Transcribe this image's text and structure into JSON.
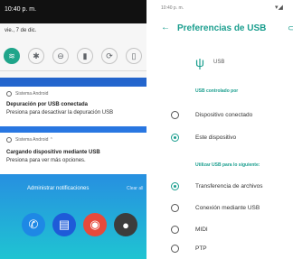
{
  "left": {
    "status_time": "10:40 p. m.",
    "date": "vie., 7 de dic.",
    "tiles": [
      {
        "icon": "wifi-icon",
        "glyph": "≋",
        "on": true
      },
      {
        "icon": "bluetooth-icon",
        "glyph": "✱",
        "on": false
      },
      {
        "icon": "dnd-icon",
        "glyph": "⊖",
        "on": false
      },
      {
        "icon": "flashlight-icon",
        "glyph": "▮",
        "on": false
      },
      {
        "icon": "autorotate-icon",
        "glyph": "⟳",
        "on": false
      },
      {
        "icon": "battery-saver-icon",
        "glyph": "▯",
        "on": false
      }
    ],
    "notifications": [
      {
        "app": "Sistema Android",
        "title": "Depuración por USB conectada",
        "body": "Presiona para desactivar la depuración USB"
      },
      {
        "app": "Sistema Android ⌃",
        "title": "Cargando dispositivo mediante USB",
        "body": "Presiona para ver más opciones."
      }
    ],
    "manage": "Administrar notificaciones",
    "clear": "Clear all",
    "dock": [
      {
        "icon": "phone-app-icon",
        "color": "#1e88e5",
        "glyph": "✆"
      },
      {
        "icon": "messages-app-icon",
        "color": "#1e5bd8",
        "glyph": "▤"
      },
      {
        "icon": "chrome-app-icon",
        "color": "#e64a3c",
        "glyph": "◉"
      },
      {
        "icon": "camera-app-icon",
        "color": "#3c3c3c",
        "glyph": "●"
      }
    ]
  },
  "right": {
    "status_time": "10:40 p. m.",
    "status_icons": "▾◢",
    "title": "Preferencias de USB",
    "usb_label": "USB",
    "section1": "USB controlado por",
    "controlled_by": [
      {
        "label": "Dispositivo conectado",
        "selected": false
      },
      {
        "label": "Este dispositivo",
        "selected": true
      }
    ],
    "section2": "Utilizar USB para lo siguiente:",
    "use_for": [
      {
        "label": "Transferencia de archivos",
        "selected": true
      },
      {
        "label": "Conexión mediante USB",
        "selected": false
      },
      {
        "label": "MIDI",
        "selected": false
      },
      {
        "label": "PTP",
        "selected": false
      }
    ]
  },
  "colors": {
    "accent": "#1a9e8e",
    "tile_on": "#1fa58a"
  }
}
